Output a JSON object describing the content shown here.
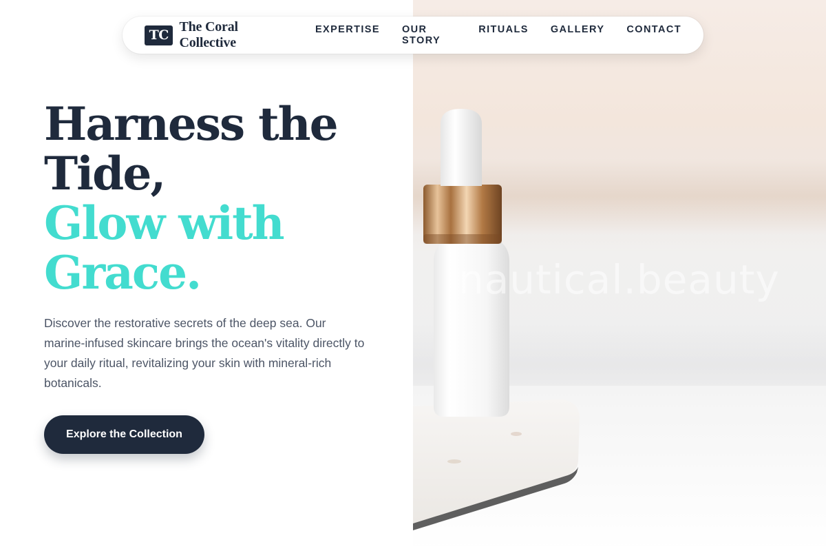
{
  "brand": {
    "mark": "TC",
    "name": "The Coral Collective"
  },
  "nav": {
    "items": [
      {
        "label": "EXPERTISE"
      },
      {
        "label": "OUR STORY"
      },
      {
        "label": "RITUALS"
      },
      {
        "label": "GALLERY"
      },
      {
        "label": "CONTACT"
      }
    ]
  },
  "hero": {
    "headline_dark": "Harness the Tide,",
    "headline_accent": "Glow with Grace.",
    "description": "Discover the restorative secrets of the deep sea. Our marine-infused skincare brings the ocean's vitality directly to your daily ritual, revitalizing your skin with mineral-rich botanicals.",
    "cta_label": "Explore the Collection"
  },
  "image": {
    "watermark": "nautical.beauty",
    "subject": "serum-dropper-bottle-icon"
  },
  "colors": {
    "primary": "#1f2a3c",
    "accent": "#43dccf",
    "body_text": "#4c5566",
    "cap_gold": "#c89a66"
  }
}
